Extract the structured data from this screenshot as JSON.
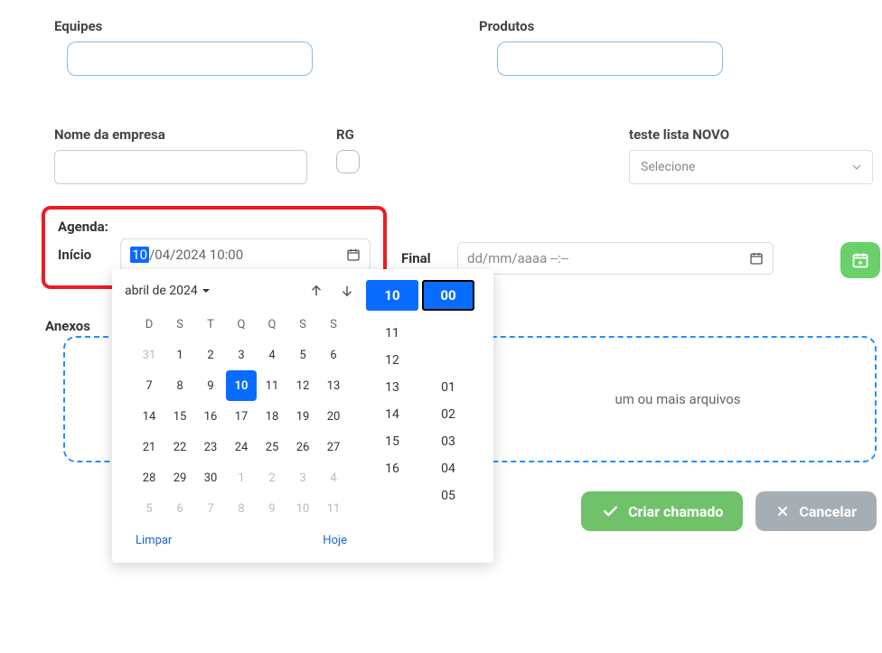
{
  "equipes": {
    "label": "Equipes"
  },
  "produtos": {
    "label": "Produtos"
  },
  "empresa": {
    "label": "Nome da empresa"
  },
  "rg": {
    "label": "RG"
  },
  "lista": {
    "label": "teste lista NOVO",
    "selected": "Selecione"
  },
  "agenda": {
    "label": "Agenda:",
    "inicio_label": "Início",
    "final_label": "Final",
    "inicio_value_day": "10",
    "inicio_value_rest": "/04/2024 10:00",
    "final_placeholder": "dd/mm/aaaa --:--"
  },
  "anexos": {
    "label": "Anexos",
    "dropzone_text_suffix": "um ou mais arquivos"
  },
  "actions": {
    "create": "Criar chamado",
    "cancel": "Cancelar"
  },
  "datepicker": {
    "month_label": "abril de 2024",
    "dows": [
      "D",
      "S",
      "T",
      "Q",
      "Q",
      "S",
      "S"
    ],
    "weeks": [
      [
        {
          "d": "31",
          "muted": true
        },
        {
          "d": "1"
        },
        {
          "d": "2"
        },
        {
          "d": "3"
        },
        {
          "d": "4"
        },
        {
          "d": "5"
        },
        {
          "d": "6"
        }
      ],
      [
        {
          "d": "7"
        },
        {
          "d": "8"
        },
        {
          "d": "9"
        },
        {
          "d": "10",
          "selected": true
        },
        {
          "d": "11"
        },
        {
          "d": "12"
        },
        {
          "d": "13"
        }
      ],
      [
        {
          "d": "14"
        },
        {
          "d": "15"
        },
        {
          "d": "16"
        },
        {
          "d": "17"
        },
        {
          "d": "18"
        },
        {
          "d": "19"
        },
        {
          "d": "20"
        }
      ],
      [
        {
          "d": "21"
        },
        {
          "d": "22"
        },
        {
          "d": "23"
        },
        {
          "d": "24"
        },
        {
          "d": "25"
        },
        {
          "d": "26"
        },
        {
          "d": "27"
        }
      ],
      [
        {
          "d": "28"
        },
        {
          "d": "29"
        },
        {
          "d": "30"
        },
        {
          "d": "1",
          "muted": true
        },
        {
          "d": "2",
          "muted": true
        },
        {
          "d": "3",
          "muted": true
        },
        {
          "d": "4",
          "muted": true
        }
      ],
      [
        {
          "d": "5",
          "muted": true
        },
        {
          "d": "6",
          "muted": true
        },
        {
          "d": "7",
          "muted": true
        },
        {
          "d": "8",
          "muted": true
        },
        {
          "d": "9",
          "muted": true
        },
        {
          "d": "10",
          "muted": true
        },
        {
          "d": "11",
          "muted": true
        }
      ]
    ],
    "clear": "Limpar",
    "today": "Hoje",
    "hour_selected": "10",
    "minute_selected": "00",
    "hours_list": [
      "11",
      "12",
      "13",
      "14",
      "15",
      "16"
    ],
    "minutes_list": [
      "01",
      "02",
      "03",
      "04",
      "05"
    ]
  }
}
